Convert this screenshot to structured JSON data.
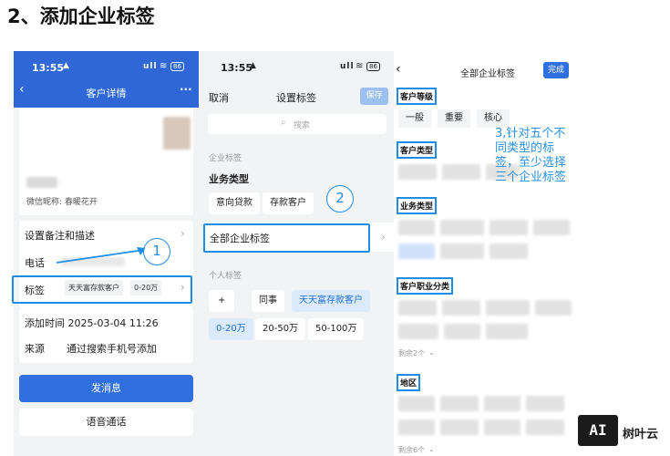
{
  "heading": "2、添加企业标签",
  "phone1": {
    "time": "13:55",
    "signal": "ull",
    "battery": "86",
    "nav_title": "客户详情",
    "back_icon": "chevron-left-icon",
    "menu_icon": "ellipsis-icon",
    "wechat_label": "微信昵称: 春暖花开",
    "rows": {
      "remark": "设置备注和描述",
      "phone": "电话",
      "tags_label": "标签",
      "tag1": "天天富存款客户",
      "tag2": "0-20万",
      "add_time": "添加时间 2025-03-04 11:26",
      "source_label": "来源",
      "source_value": "通过搜索手机号添加"
    },
    "send_message": "发消息",
    "voice_call": "语音通话"
  },
  "phone2": {
    "time": "13:55",
    "signal": "ull",
    "battery": "86",
    "cancel": "取消",
    "nav_title": "设置标签",
    "save": "保存",
    "search_placeholder": "搜索",
    "enterprise_section": "企业标签",
    "business_type": "业务类型",
    "chip_intent_loan": "意向贷款",
    "chip_deposit": "存款客户",
    "all_enterprise_tags": "全部企业标签",
    "personal_section": "个人标签",
    "chip_add": "+",
    "chip_colleague": "同事",
    "chip_tiantian": "天天富存款客户",
    "chip_0_20": "0-20万",
    "chip_20_50": "20-50万",
    "chip_50_100": "50-100万"
  },
  "phone3": {
    "back_icon": "chevron-left-icon",
    "nav_title": "全部企业标签",
    "done": "完成",
    "customer_level": "客户等级",
    "level_general": "一般",
    "level_important": "重要",
    "level_core": "核心",
    "customer_type": "客户类型",
    "business_type": "业务类型",
    "customer_profession": "客户职业分类",
    "remaining_2": "剩余2个",
    "region": "地区",
    "remaining_6": "剩余6个"
  },
  "annotations": {
    "num1": "1",
    "num2": "2",
    "instruction": "3,针对五个不同类型的标签，至少选择三个企业标签"
  },
  "watermark": {
    "logo": "AI",
    "name": "树叶云"
  },
  "colors": {
    "brand_blue": "#2f68d6",
    "button_blue": "#2f6fe0",
    "callout_blue": "#1f8de6",
    "chip_blue_bg": "#dcebfb"
  }
}
